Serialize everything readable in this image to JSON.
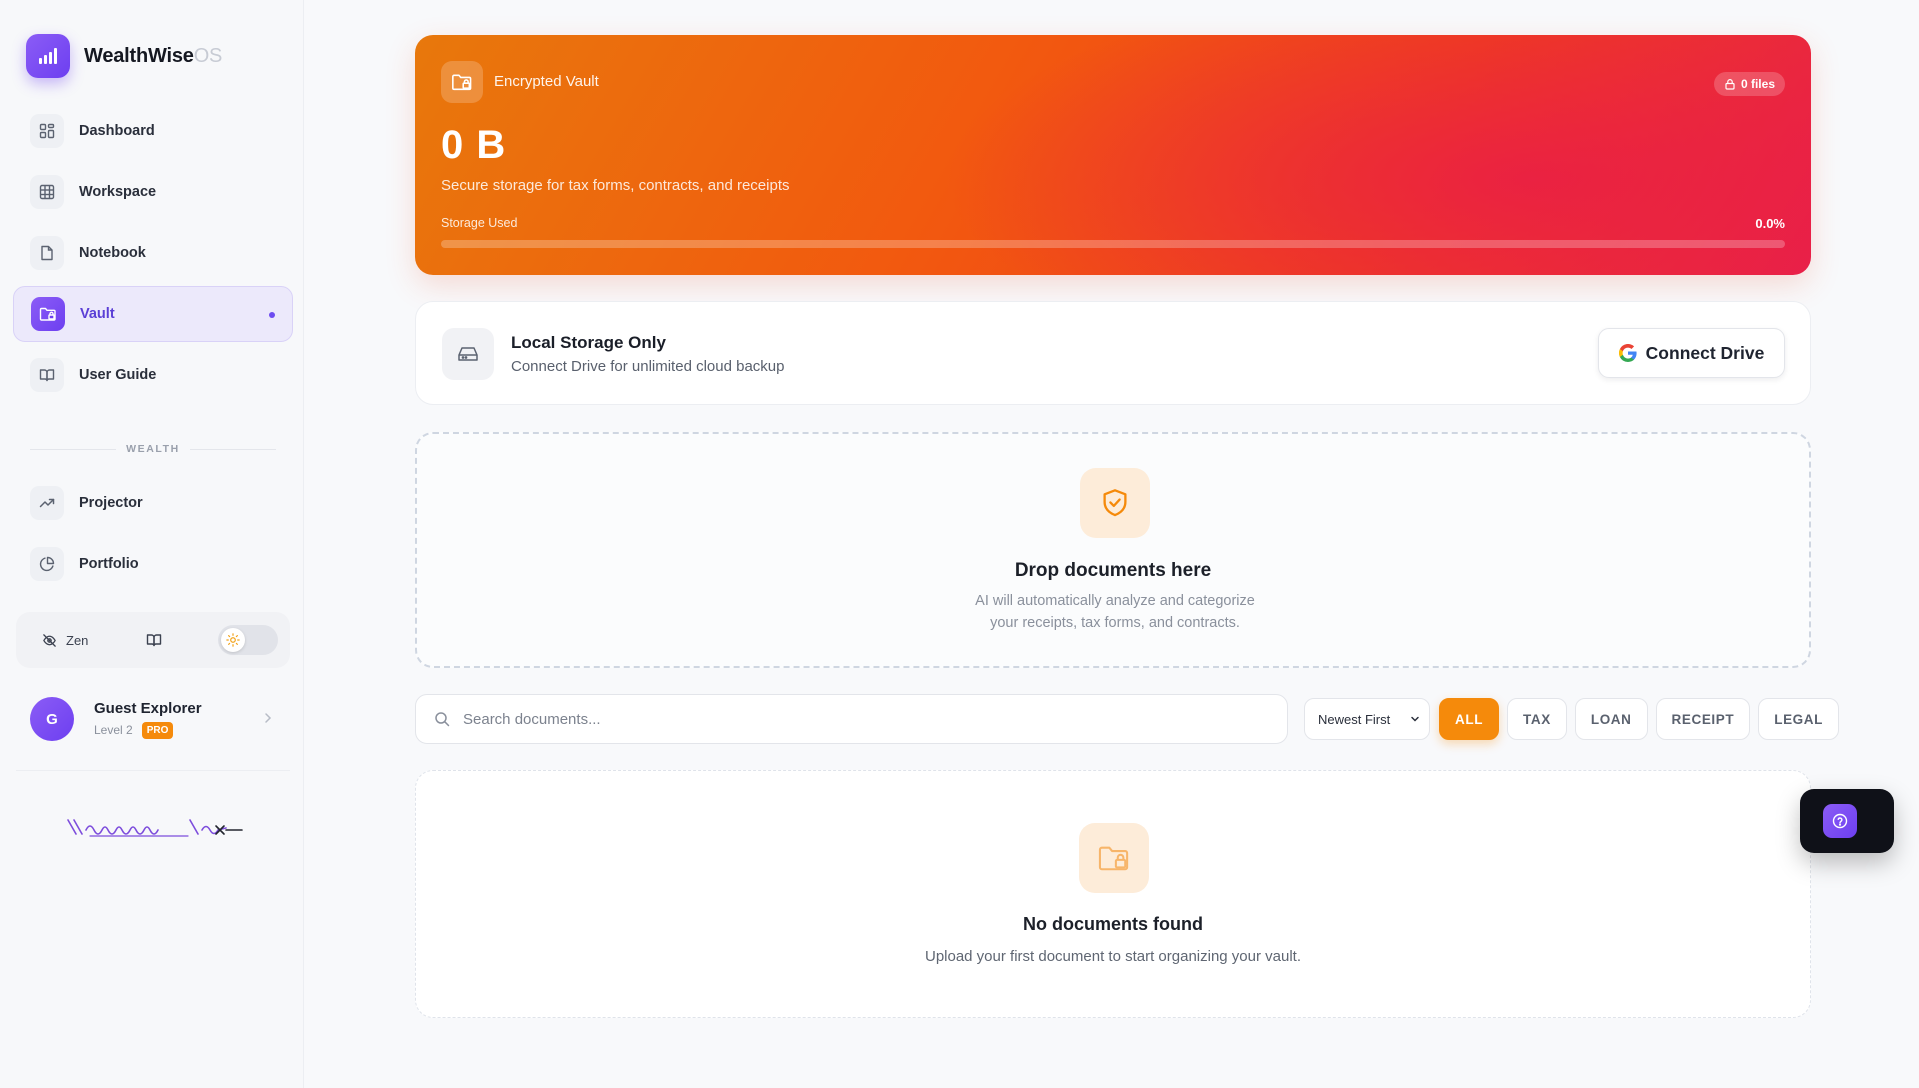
{
  "app": {
    "name": "WealthWise",
    "name_suffix": "OS"
  },
  "sidebar": {
    "items": [
      {
        "label": "Dashboard",
        "icon": "dashboard-grid-icon"
      },
      {
        "label": "Workspace",
        "icon": "table-grid-icon"
      },
      {
        "label": "Notebook",
        "icon": "file-icon"
      },
      {
        "label": "Vault",
        "icon": "folder-lock-icon",
        "active": true
      },
      {
        "label": "User Guide",
        "icon": "book-open-icon"
      }
    ],
    "section_label": "WEALTH",
    "wealth_items": [
      {
        "label": "Projector",
        "icon": "trending-up-icon"
      },
      {
        "label": "Portfolio",
        "icon": "pie-chart-icon"
      }
    ],
    "toolbar": {
      "zen_label": "Zen",
      "zen_icon": "eye-off-icon",
      "guide_icon": "book-open-icon",
      "theme_icon": "sun-icon"
    },
    "profile": {
      "initial": "G",
      "name": "Guest Explorer",
      "level": "Level 2",
      "badge": "PRO"
    }
  },
  "vault_header": {
    "title": "Encrypted Vault",
    "files_badge": "0 files",
    "size": "0 B",
    "subtitle": "Secure storage for tax forms, contracts, and receipts",
    "storage_label": "Storage Used",
    "storage_percent": "0.0%",
    "storage_fraction": 0.0
  },
  "storage_card": {
    "title": "Local Storage Only",
    "subtitle": "Connect Drive for unlimited cloud backup",
    "button_label": "Connect Drive"
  },
  "drop_zone": {
    "title": "Drop documents here",
    "subtitle": "AI will automatically analyze and categorize your receipts, tax forms, and contracts."
  },
  "search": {
    "placeholder": "Search documents...",
    "value": ""
  },
  "sort": {
    "selected": "Newest First"
  },
  "filters": [
    {
      "label": "ALL",
      "active": true
    },
    {
      "label": "TAX",
      "active": false
    },
    {
      "label": "LOAN",
      "active": false
    },
    {
      "label": "RECEIPT",
      "active": false
    },
    {
      "label": "LEGAL",
      "active": false
    }
  ],
  "empty_state": {
    "title": "No documents found",
    "subtitle": "Upload your first document to start organizing your vault."
  },
  "colors": {
    "accent_purple": "#6d3ff0",
    "accent_orange": "#f58a0b",
    "hero_gradient_start": "#e8780c",
    "hero_gradient_end": "#e8204a"
  }
}
